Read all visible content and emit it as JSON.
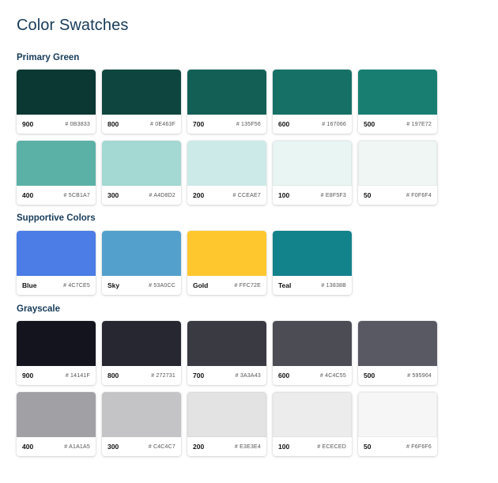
{
  "title": "Color Swatches",
  "sections": [
    {
      "title": "Primary Green",
      "swatches": [
        {
          "name": "900",
          "hex": "# 0B3833",
          "color": "#0B3833"
        },
        {
          "name": "800",
          "hex": "# 0E463F",
          "color": "#0E463F"
        },
        {
          "name": "700",
          "hex": "# 135F56",
          "color": "#135F56"
        },
        {
          "name": "600",
          "hex": "# 167066",
          "color": "#167066"
        },
        {
          "name": "500",
          "hex": "# 197E72",
          "color": "#197E72"
        },
        {
          "name": "400",
          "hex": "# 5CB1A7",
          "color": "#5CB1A7"
        },
        {
          "name": "300",
          "hex": "# A4D8D2",
          "color": "#A4D8D2"
        },
        {
          "name": "200",
          "hex": "# CCEAE7",
          "color": "#CCEAE7"
        },
        {
          "name": "100",
          "hex": "# E8F5F3",
          "color": "#E8F5F3"
        },
        {
          "name": "50",
          "hex": "# F0F6F4",
          "color": "#F0F6F4"
        }
      ]
    },
    {
      "title": "Supportive Colors",
      "swatches": [
        {
          "name": "Blue",
          "hex": "# 4C7CE5",
          "color": "#4C7CE5"
        },
        {
          "name": "Sky",
          "hex": "# 53A0CC",
          "color": "#53A0CC"
        },
        {
          "name": "Gold",
          "hex": "# FFC72E",
          "color": "#FFC72E"
        },
        {
          "name": "Teal",
          "hex": "# 13838B",
          "color": "#13838B"
        }
      ]
    },
    {
      "title": "Grayscale",
      "swatches": [
        {
          "name": "900",
          "hex": "# 14141F",
          "color": "#14141F"
        },
        {
          "name": "800",
          "hex": "# 272731",
          "color": "#272731"
        },
        {
          "name": "700",
          "hex": "# 3A3A43",
          "color": "#3A3A43"
        },
        {
          "name": "600",
          "hex": "# 4C4C55",
          "color": "#4C4C55"
        },
        {
          "name": "500",
          "hex": "# 595964",
          "color": "#595964"
        },
        {
          "name": "400",
          "hex": "# A1A1A5",
          "color": "#A1A1A5"
        },
        {
          "name": "300",
          "hex": "# C4C4C7",
          "color": "#C4C4C7"
        },
        {
          "name": "200",
          "hex": "# E3E3E4",
          "color": "#E3E3E4"
        },
        {
          "name": "100",
          "hex": "# ECECED",
          "color": "#ECECED"
        },
        {
          "name": "50",
          "hex": "# F6F6F6",
          "color": "#F6F6F6"
        }
      ]
    }
  ]
}
